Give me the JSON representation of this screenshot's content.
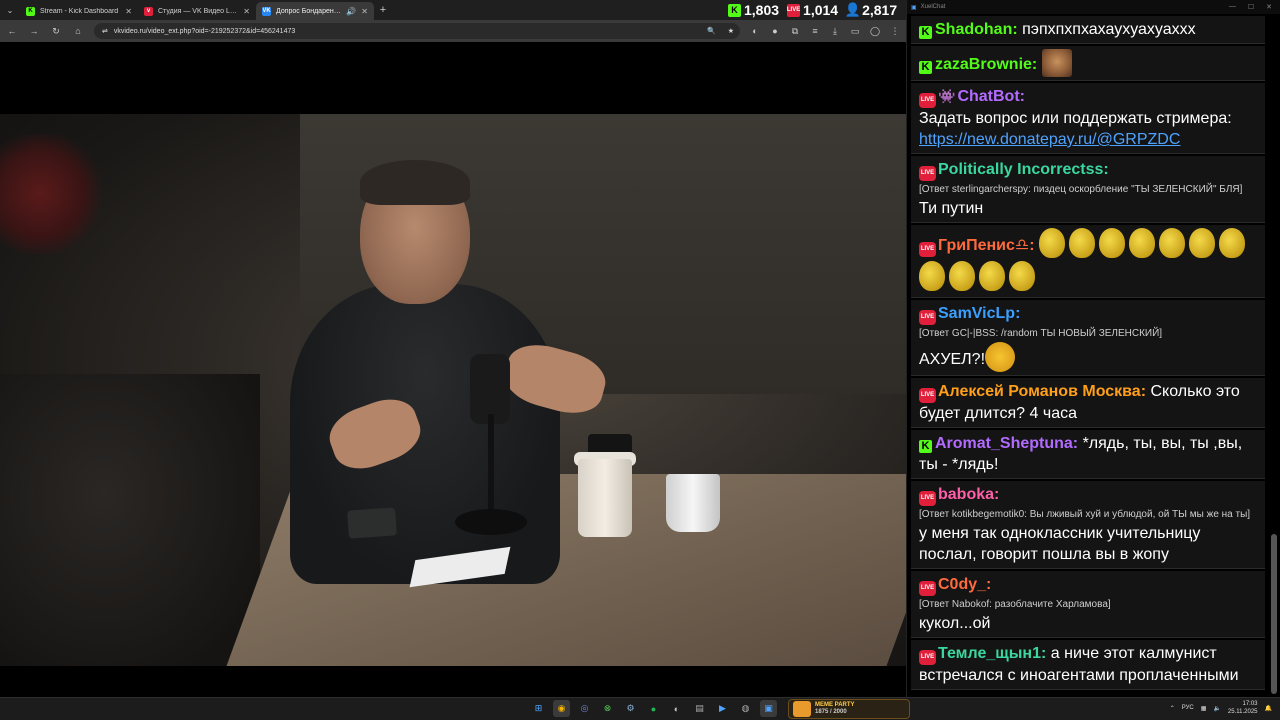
{
  "browser": {
    "tabs": [
      {
        "label": "Stream - Kick Dashboard",
        "fav_color": "#53fc18",
        "fav_letter": "K"
      },
      {
        "label": "Студия — VK Видео Live",
        "fav_color": "#e0203a",
        "fav_letter": "v"
      },
      {
        "label": "Допрос Бондаренко нарк",
        "fav_color": "#2787f5",
        "fav_letter": "VK"
      }
    ],
    "url": "vkvideo.ru/video_ext.php?oid=-219252372&id=456241473"
  },
  "stats": {
    "kick_viewers": "1,803",
    "vk_viewers": "1,014",
    "total_viewers": "2,817"
  },
  "chat": {
    "window_title": "XuelChat",
    "messages": [
      {
        "platform": "kick",
        "name": "Shadohan",
        "name_color": "#53fc18",
        "text": "пэпхпхпхахаухуахуахxx"
      },
      {
        "platform": "kick",
        "name": "zazaBrownie",
        "name_color": "#53fc18",
        "text": "",
        "emote": "face"
      },
      {
        "platform": "vk",
        "bot": true,
        "name": "ChatBot",
        "name_color": "#b36bff",
        "text": "Задать вопрос или поддержать стримера:",
        "link": "https://new.donatepay.ru/@GRPZDC"
      },
      {
        "platform": "vk",
        "name": "Politically Incorrectss",
        "name_color": "#3ad7a0",
        "reply": "[Ответ sterlingarchersру: пиздец оскорбление \"ТЫ ЗЕЛЕНСКИЙ\" БЛЯ]",
        "text": "Ти путин"
      },
      {
        "platform": "vk",
        "name": "ГриПенис♎",
        "name_color": "#ff6a3d",
        "text": "",
        "emote": "eggs"
      },
      {
        "platform": "vk",
        "name": "SamVicLp",
        "name_color": "#3aa0ff",
        "reply": "[Ответ GC|-|BSS: /random ТЫ НОВЫЙ ЗЕЛЕНСКИЙ]",
        "text": "АХУЕЛ?!",
        "emote": "lol"
      },
      {
        "platform": "vk",
        "name": "Алексей Романов Москва",
        "name_color": "#ff9f1a",
        "text": "Сколько это будет длится? 4 часа"
      },
      {
        "platform": "kick",
        "name": "Aromat_Sheptuna",
        "name_color": "#b36bff",
        "text": "*лядь, ты, вы, ты ,вы, ты - *лядь!"
      },
      {
        "platform": "vk",
        "name": "baboka",
        "name_color": "#ff5fa8",
        "reply": "[Ответ kotikbegemotik0: Вы лживый хуй и ублюдой, ой ТЫ мы же на ты]",
        "text": "у меня так одноклассник учительницу послал, говорит пошла вы в жопу"
      },
      {
        "platform": "vk",
        "name": "C0dy_",
        "name_color": "#ff6a3d",
        "reply": "[Ответ Nabokof: разоблачите Харламова]",
        "text": "кукол...ой"
      },
      {
        "platform": "vk",
        "name": "Темле_щын1",
        "name_color": "#3ad7a0",
        "text": "а ниче этот калмунист встречался с иноагентами проплаченными"
      }
    ]
  },
  "taskbar": {
    "widget_title": "MEME PARTY",
    "widget_sub": "1875 / 2000",
    "lang": "РУС",
    "time": "17:03",
    "date": "25.11.2025"
  }
}
